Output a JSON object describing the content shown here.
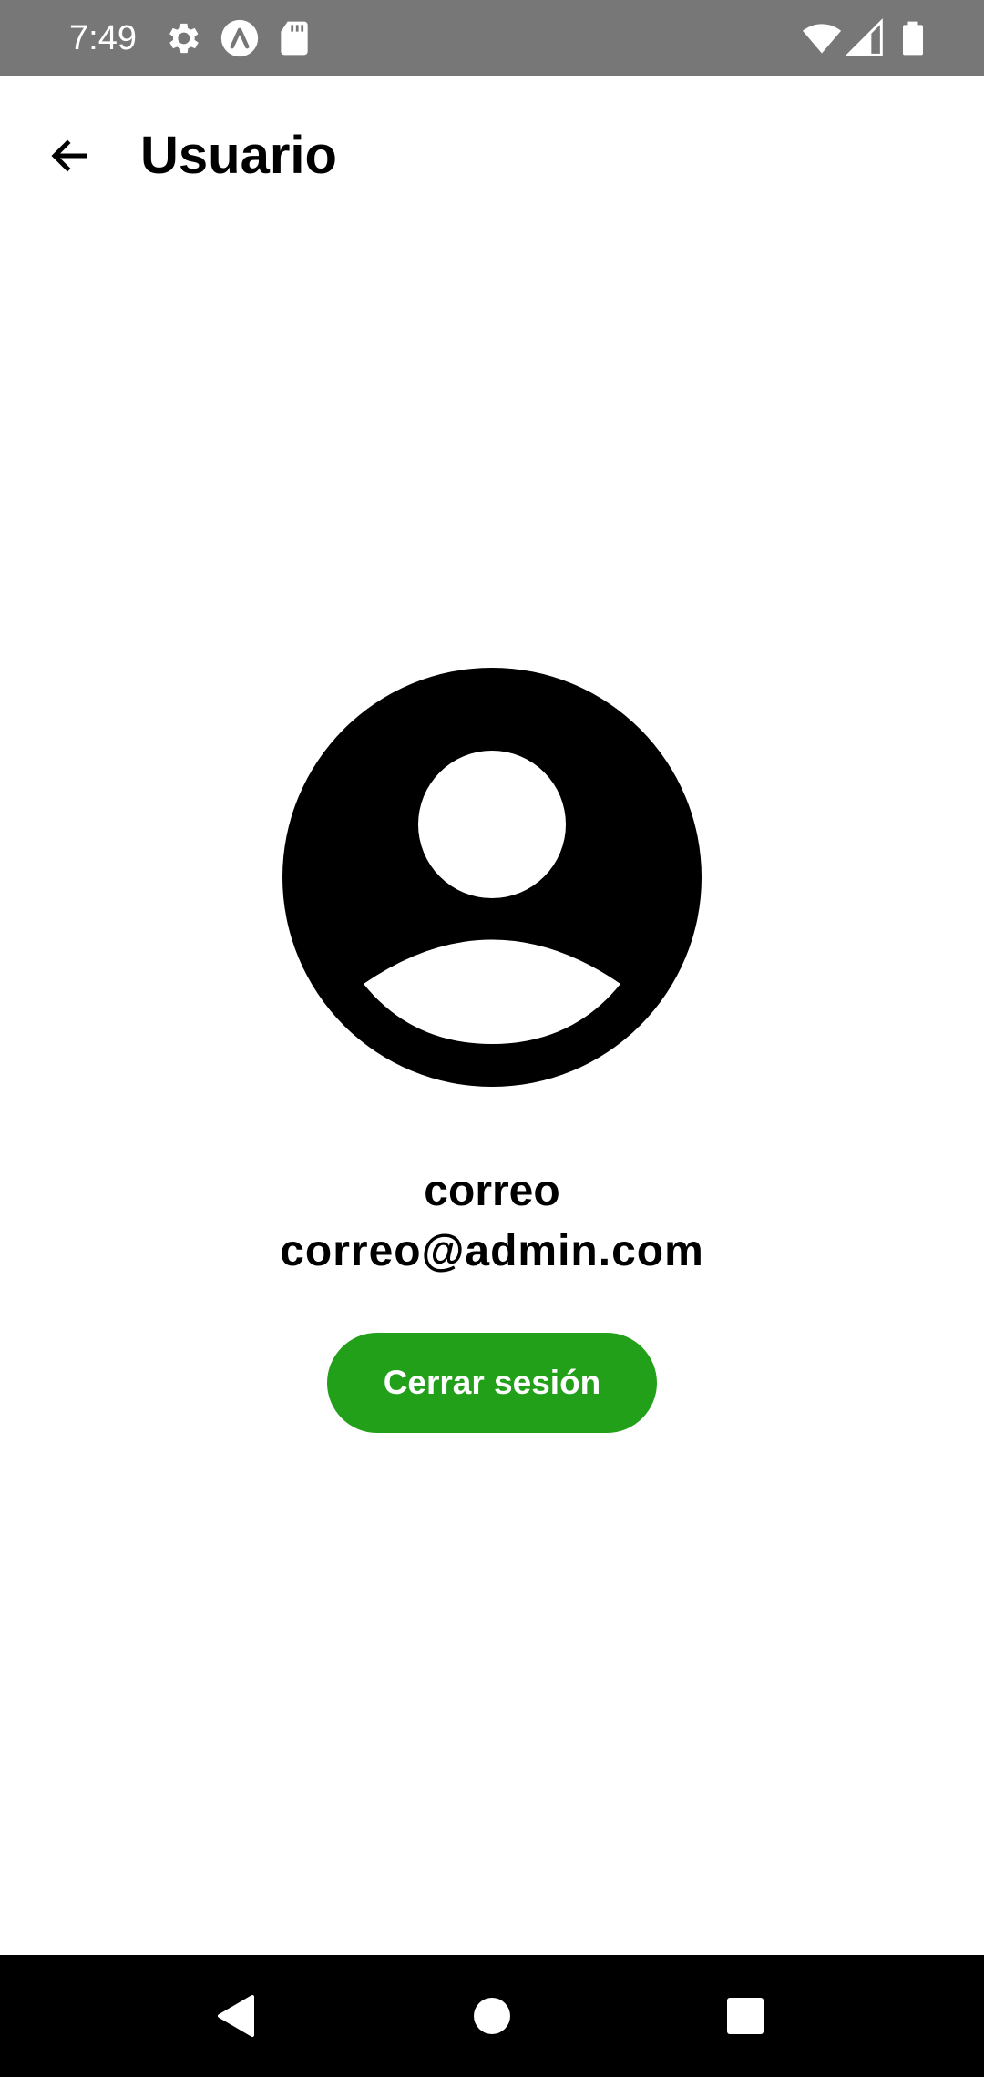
{
  "status_bar": {
    "time": "7:49",
    "left_icons": [
      "gear-icon",
      "a-circle-icon",
      "sd-card-icon"
    ],
    "right_icons": [
      "wifi-icon",
      "signal-icon",
      "battery-icon"
    ]
  },
  "app_bar": {
    "back_icon": "arrow-left-icon",
    "title": "Usuario"
  },
  "profile": {
    "avatar_icon": "account-circle-icon",
    "name": "correo",
    "email": "correo@admin.com"
  },
  "actions": {
    "logout_label": "Cerrar sesión",
    "logout_color": "#22a01a"
  },
  "nav_bar": {
    "icons": [
      "back-triangle-icon",
      "home-circle-icon",
      "recents-square-icon"
    ]
  },
  "colors": {
    "status_bar": "#777777",
    "nav_bar": "#000000",
    "background": "#ffffff"
  }
}
